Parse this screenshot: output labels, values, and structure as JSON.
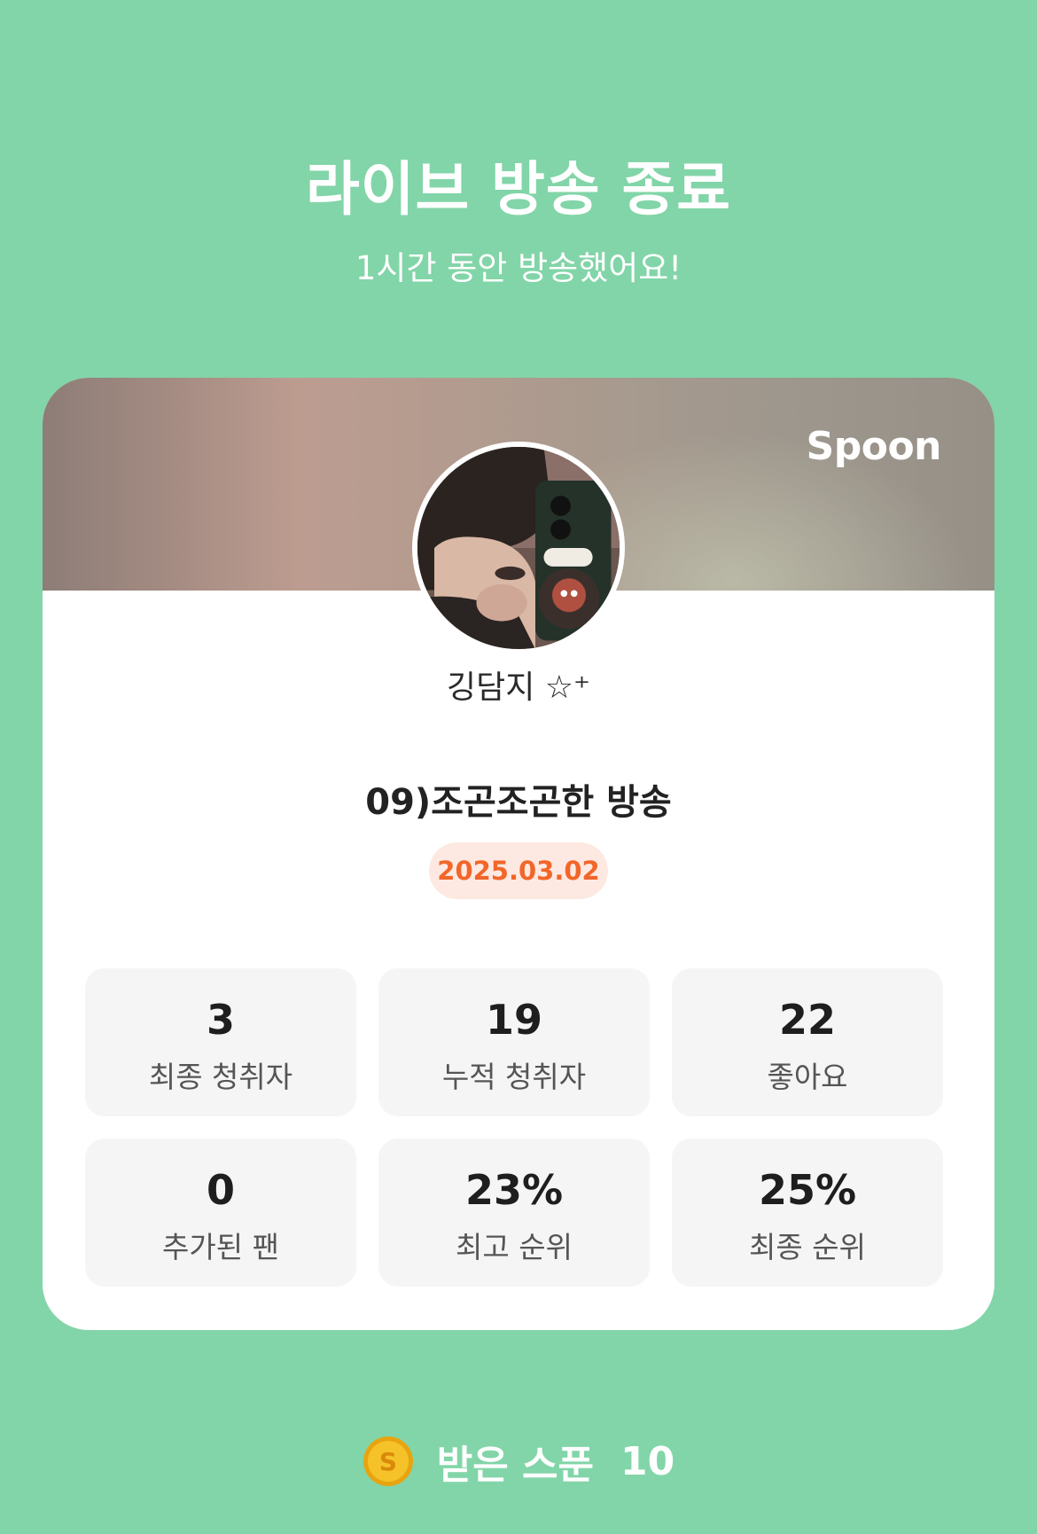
{
  "header": {
    "title": "라이브 방송 종료",
    "subtitle": "1시간 동안 방송했어요!"
  },
  "card": {
    "brand": "Spoon",
    "nickname": "깅담지 ☆⁺",
    "broadcast_title": "09)조곤조곤한 방송",
    "date": "2025.03.02",
    "stats": [
      {
        "value": "3",
        "label": "최종 청취자"
      },
      {
        "value": "19",
        "label": "누적 청취자"
      },
      {
        "value": "22",
        "label": "좋아요"
      },
      {
        "value": "0",
        "label": "추가된 팬"
      },
      {
        "value": "23%",
        "label": "최고 순위"
      },
      {
        "value": "25%",
        "label": "최종 순위"
      }
    ]
  },
  "footer": {
    "coin_icon": "spoon-coin-icon",
    "received_label": "받은 스푼",
    "received_value": "10"
  },
  "colors": {
    "background": "#82d5a8",
    "date_text": "#f2662a",
    "date_bg": "#fde9e1",
    "coin": "#f5b81c"
  }
}
